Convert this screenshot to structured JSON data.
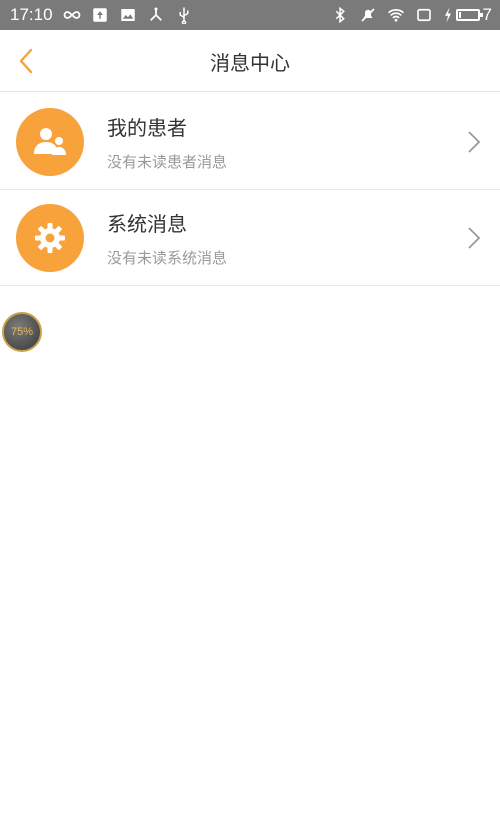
{
  "status_bar": {
    "time": "17:10",
    "battery_text": "7",
    "icons": [
      "infinity-icon",
      "upload-icon",
      "mail-image-icon",
      "network-icon",
      "usb-icon",
      "bluetooth-icon",
      "mute-icon",
      "wifi-icon",
      "screen-icon",
      "charging-icon",
      "battery-icon"
    ]
  },
  "header": {
    "title": "消息中心",
    "back_icon": "chevron-left-icon"
  },
  "colors": {
    "accent": "#f7a23a",
    "status_bar_bg": "#7a7a7a",
    "title_text": "#333333",
    "subtitle_text": "#9a9a9a"
  },
  "messages": [
    {
      "title": "我的患者",
      "subtitle": "没有未读患者消息",
      "icon": "patients-icon"
    },
    {
      "title": "系统消息",
      "subtitle": "没有未读系统消息",
      "icon": "gear-icon"
    }
  ],
  "floating_badge": {
    "label": "75%"
  }
}
